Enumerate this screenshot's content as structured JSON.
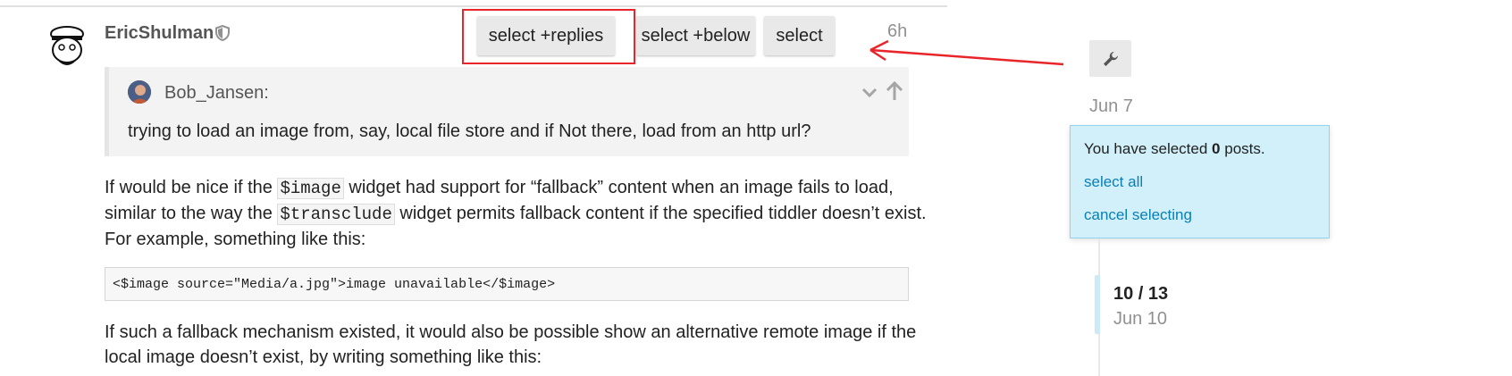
{
  "post": {
    "username": "EricShulman",
    "date": "6h",
    "quote": {
      "username": "Bob_Jansen:",
      "text": "trying to load an image from, say, local file store and if Not there, load from an http url?"
    },
    "para1": {
      "l1a": "If would be nice if the ",
      "code1": "$image",
      "l1b": " widget had support for “fallback” content when an image fails to load,",
      "l2a": "similar to the way the ",
      "code2": "$transclude",
      "l2b": " widget permits fallback content if the specified tiddler doesn’t exist.",
      "l3": "For example, something like this:"
    },
    "code_block": "<$image source=\"Media/a.jpg\">image unavailable</$image>",
    "para2": {
      "l1": "If such a fallback mechanism existed, it would also be possible show an alternative remote image if the",
      "l2": "local image doesn’t exist, by writing something like this:"
    }
  },
  "select_buttons": {
    "replies": "select +replies",
    "below": "select +below",
    "select": "select"
  },
  "sidebar": {
    "date_top": "Jun 7",
    "selection": {
      "prefix": "You have selected ",
      "count": "0",
      "suffix": " posts.",
      "select_all": "select all",
      "cancel": "cancel selecting"
    },
    "timeline": {
      "position": "10 / 13",
      "date": "Jun 10"
    }
  },
  "icons": [
    "shield-icon",
    "chevron-down-icon",
    "arrow-up-icon",
    "wrench-icon"
  ],
  "colors": {
    "highlight_box": "#e8262a",
    "panel_bg": "#d1f0fa",
    "link": "#0a7fb5"
  }
}
